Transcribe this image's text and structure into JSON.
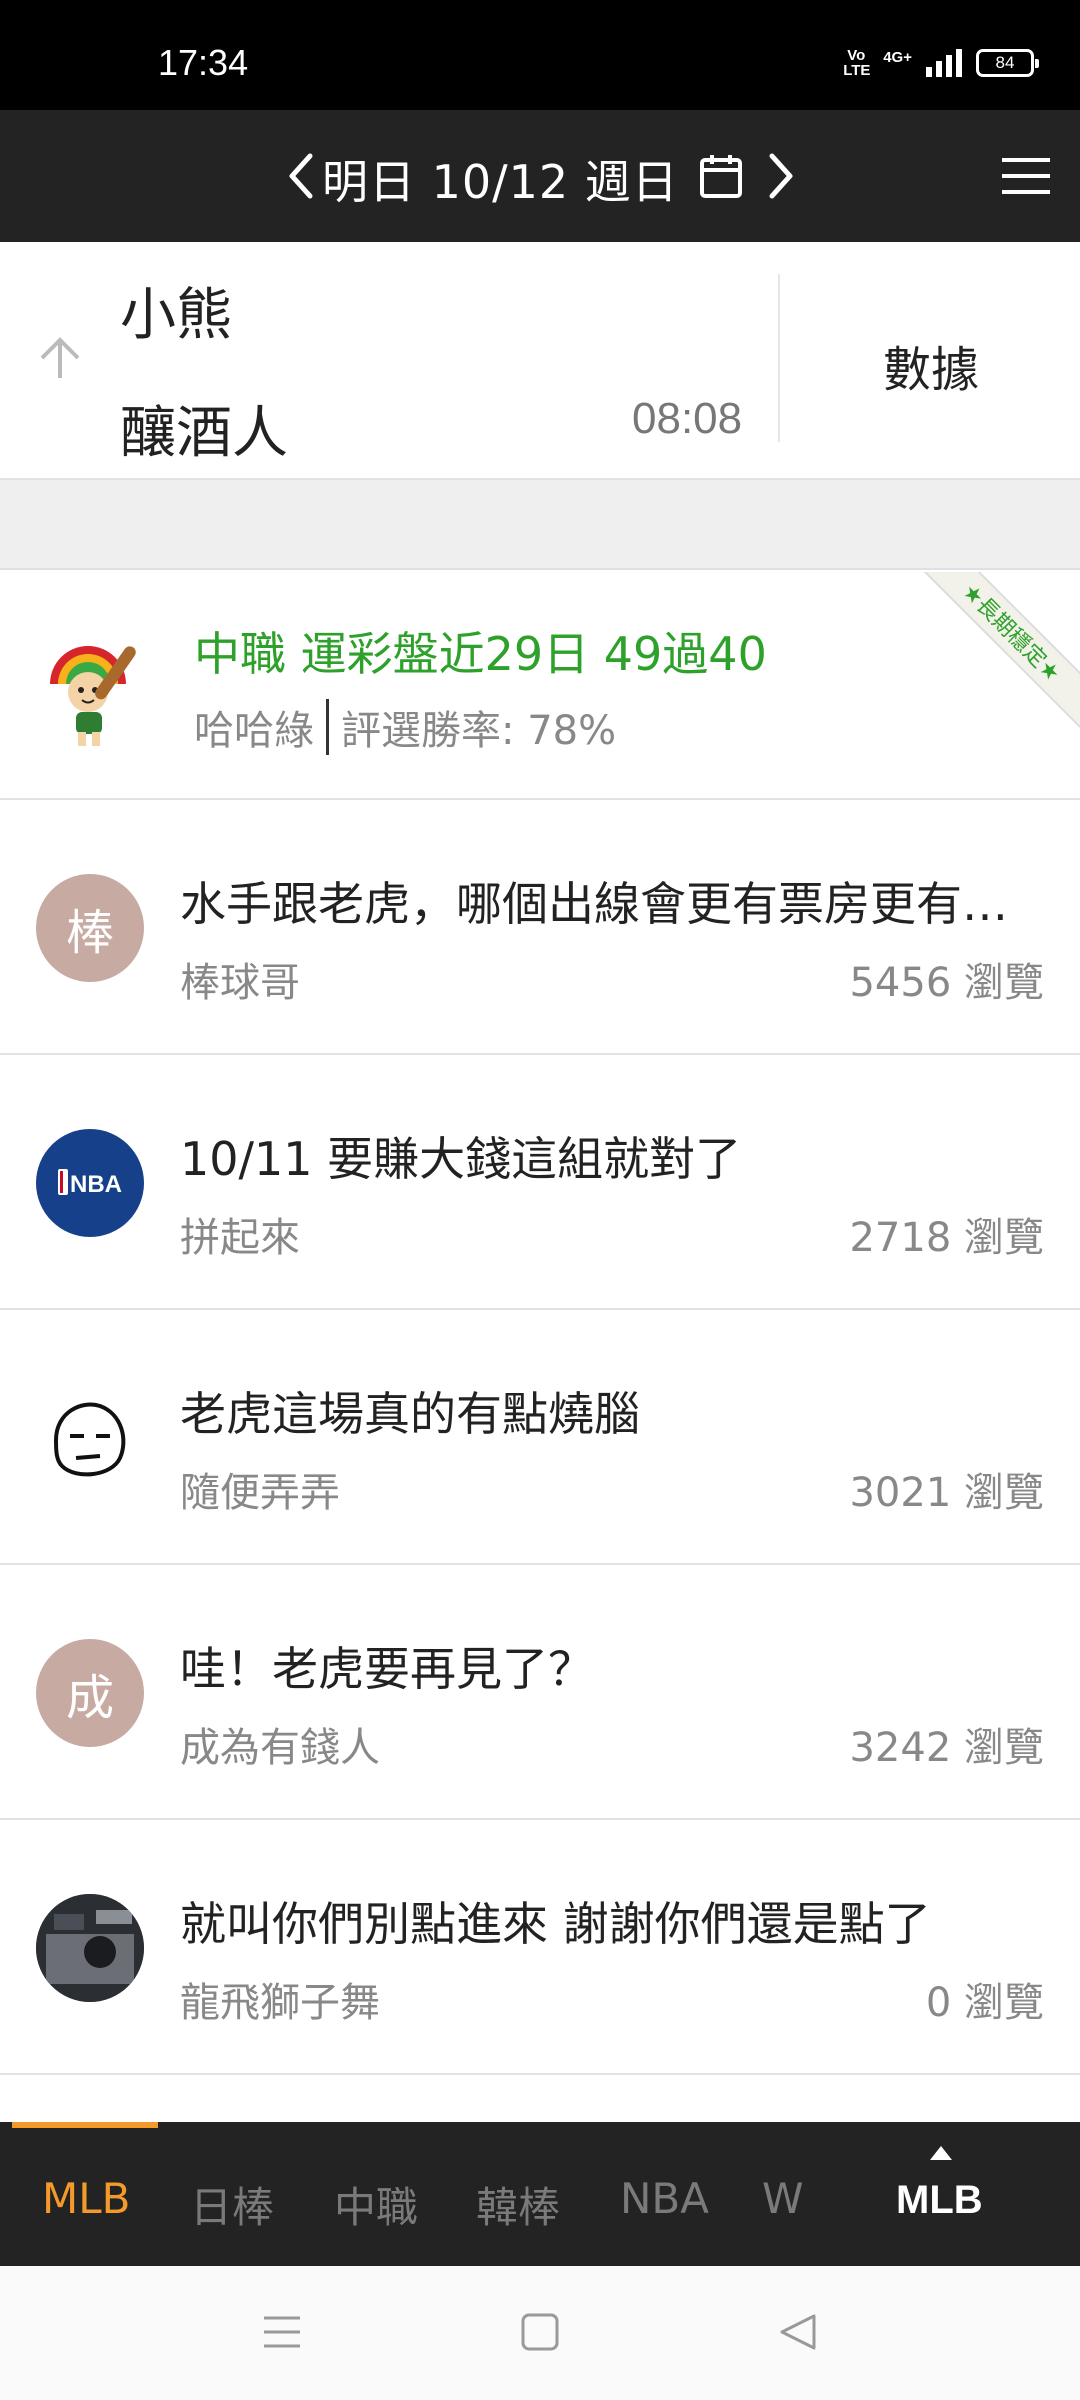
{
  "status_bar": {
    "time": "17:34",
    "volte": "Vo LTE",
    "network": "4G+",
    "battery": "84"
  },
  "header": {
    "date": "明日 10/12 週日"
  },
  "game": {
    "team_top": "小熊",
    "team_bottom": "釀酒人",
    "time": "08:08",
    "stats_label": "數據"
  },
  "promo": {
    "title": "中職 運彩盤近29日 49過40",
    "author": "哈哈綠",
    "win_rate": "評選勝率: 78%",
    "ribbon": "★長期穩定★",
    "accent": "#2ea12b"
  },
  "posts": [
    {
      "avatar_text": "棒",
      "title": "水手跟老虎，哪個出線會更有票房更有話題",
      "author": "棒球哥",
      "views": "5456 瀏覽"
    },
    {
      "avatar_text": "NBA",
      "title": "10/11 要賺大錢這組就對了",
      "author": "拼起來",
      "views": "2718 瀏覽"
    },
    {
      "avatar_text": "",
      "title": "老虎這場真的有點燒腦",
      "author": "隨便弄弄",
      "views": "3021 瀏覽"
    },
    {
      "avatar_text": "成",
      "title": "哇！老虎要再見了？",
      "author": "成為有錢人",
      "views": "3242 瀏覽"
    },
    {
      "avatar_text": "",
      "title": "就叫你們別點進來 謝謝你們還是點了",
      "author": "龍飛獅子舞",
      "views": "0 瀏覽"
    }
  ],
  "tabs": [
    "MLB",
    "日棒",
    "中職",
    "韓棒",
    "NBA",
    "W"
  ],
  "league_switch": "MLB",
  "colors": {
    "active_tab": "#f39a2b",
    "bar_bg": "#232323"
  }
}
